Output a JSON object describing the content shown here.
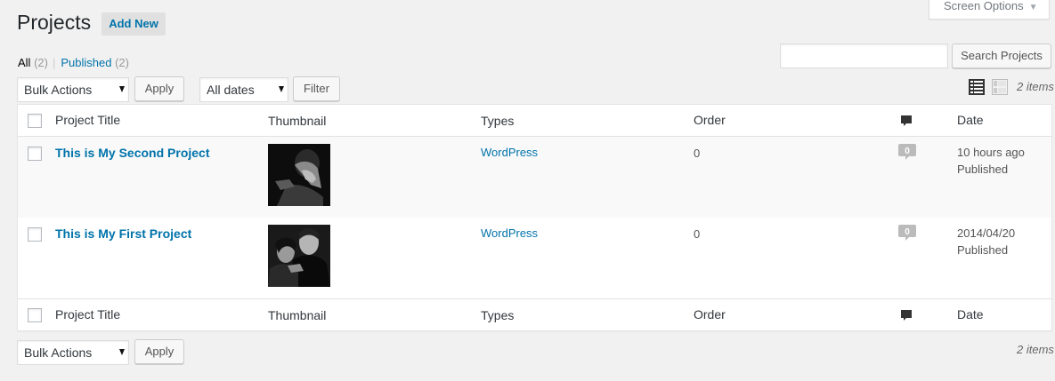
{
  "screen_options": {
    "label": "Screen Options"
  },
  "header": {
    "title": "Projects",
    "add_new": "Add New"
  },
  "filters": {
    "all": "All",
    "all_count": "(2)",
    "published": "Published",
    "published_count": "(2)"
  },
  "search": {
    "placeholder": "",
    "button": "Search Projects"
  },
  "bulk": {
    "selected": "Bulk Actions",
    "apply": "Apply"
  },
  "dates": {
    "selected": "All dates",
    "filter": "Filter"
  },
  "displaying": "2 items",
  "table": {
    "columns": {
      "title": "Project Title",
      "thumbnail": "Thumbnail",
      "types": "Types",
      "order": "Order",
      "comments_icon": "comment-icon",
      "date": "Date"
    },
    "rows": [
      {
        "title": "This is My Second Project",
        "types": "WordPress",
        "order": "0",
        "comments": "0",
        "date": "10 hours ago",
        "status": "Published"
      },
      {
        "title": "This is My First Project",
        "types": "WordPress",
        "order": "0",
        "comments": "0",
        "date": "2014/04/20",
        "status": "Published"
      }
    ]
  },
  "colors": {
    "link": "#0073aa",
    "background": "#f1f1f1",
    "badge": "#bbbbbb"
  }
}
